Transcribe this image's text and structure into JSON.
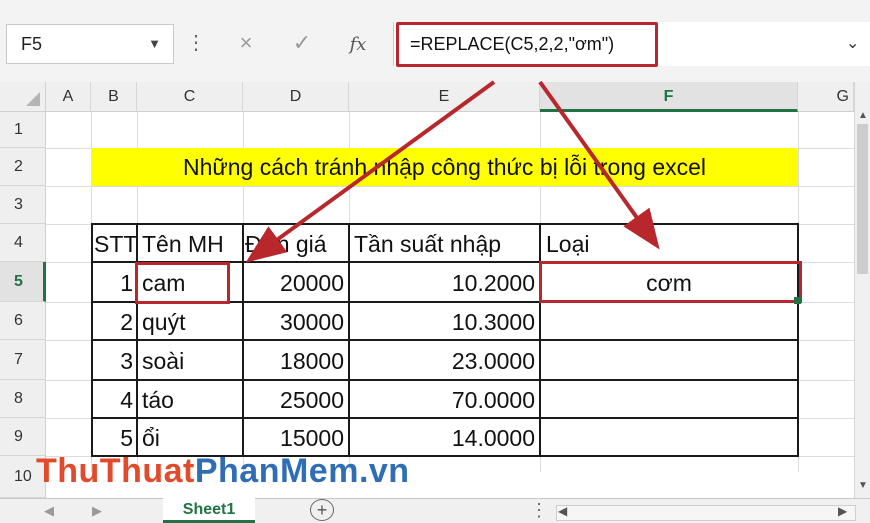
{
  "formula_bar": {
    "name_box": "F5",
    "cancel_icon": "×",
    "enter_icon": "✓",
    "fx_label": "fx",
    "formula": "=REPLACE(C5,2,2,\"ơm\")"
  },
  "columns": [
    "A",
    "B",
    "C",
    "D",
    "E",
    "F",
    "G"
  ],
  "rows": [
    "1",
    "2",
    "3",
    "4",
    "5",
    "6",
    "7",
    "8",
    "9",
    "10"
  ],
  "title": "Những cách tránh nhập công thức bị lỗi trong excel",
  "table": {
    "headers": [
      "STT",
      "Tên MH",
      "Đơn giá",
      "Tần suất nhập",
      "Loại"
    ],
    "rows": [
      [
        "1",
        "cam",
        "20000",
        "10.2000",
        "cơm"
      ],
      [
        "2",
        "quýt",
        "30000",
        "10.3000",
        ""
      ],
      [
        "3",
        "soài",
        "18000",
        "23.0000",
        ""
      ],
      [
        "4",
        "táo",
        "25000",
        "70.0000",
        ""
      ],
      [
        "5",
        "ổi",
        "15000",
        "14.0000",
        ""
      ]
    ]
  },
  "sheet_tabs": [
    "Sheet1"
  ],
  "watermark": {
    "part1": "ThuThuat",
    "part2": "PhanMem",
    "part3": ".vn"
  },
  "colors": {
    "accent": "#217346",
    "highlight": "#b7272c",
    "title_fill": "#ffff00"
  }
}
